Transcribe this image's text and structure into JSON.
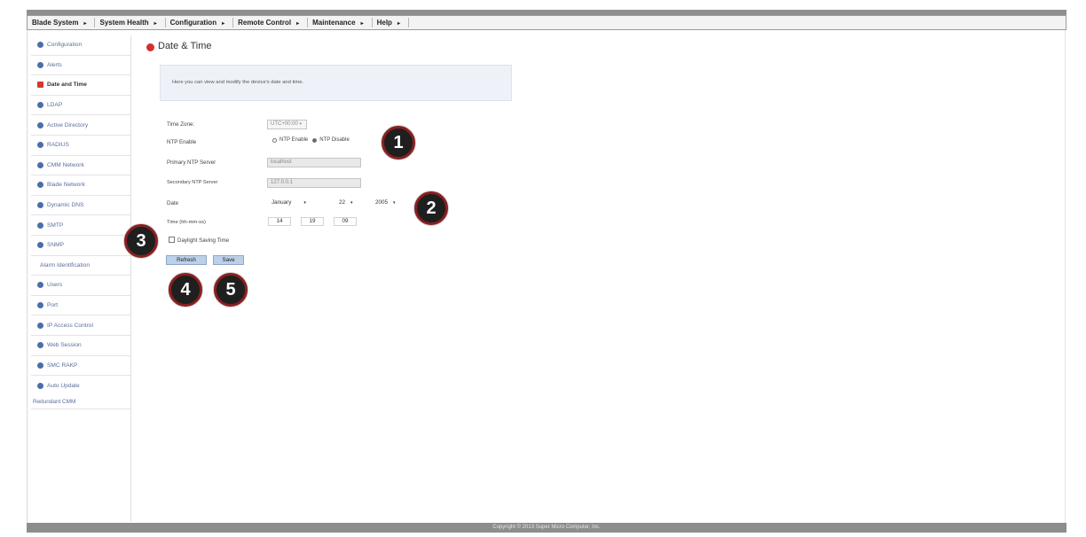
{
  "menu": [
    {
      "label": "Blade System",
      "arrow": "▸"
    },
    {
      "label": "System Health",
      "arrow": "▸"
    },
    {
      "label": "Configuration",
      "arrow": "▸"
    },
    {
      "label": "Remote Control",
      "arrow": "▸"
    },
    {
      "label": "Maintenance",
      "arrow": "▸"
    },
    {
      "label": "Help",
      "arrow": "▸"
    }
  ],
  "sidebar": {
    "items": [
      {
        "label": "Configuration",
        "icon": "config-icon"
      },
      {
        "label": "Alerts",
        "icon": "config-icon"
      },
      {
        "label": "Date and Time",
        "icon": "config-icon",
        "active": true
      },
      {
        "label": "LDAP",
        "icon": "config-icon"
      },
      {
        "label": "Active Directory",
        "icon": "config-icon"
      },
      {
        "label": "RADIUS",
        "icon": "config-icon"
      },
      {
        "label": "CMM Network",
        "icon": "config-icon"
      },
      {
        "label": "Blade Network",
        "icon": "config-icon"
      },
      {
        "label": "Dynamic DNS",
        "icon": "config-icon"
      },
      {
        "label": "SMTP",
        "icon": "config-icon"
      },
      {
        "label": "SNMP",
        "icon": "config-icon"
      },
      {
        "label": "Alarm Identification",
        "icon": ""
      },
      {
        "label": "Users",
        "icon": "config-icon"
      },
      {
        "label": "Port",
        "icon": "config-icon"
      },
      {
        "label": "IP Access Control",
        "icon": "config-icon"
      },
      {
        "label": "Web Session",
        "icon": "config-icon"
      },
      {
        "label": "SMC RAKP",
        "icon": "config-icon"
      },
      {
        "label": "Auto Update",
        "icon": "config-icon"
      }
    ],
    "tail": "Redundant CMM"
  },
  "page": {
    "title": "Date & Time",
    "info": "Here you can view and modify the device's date and time."
  },
  "form": {
    "time_zone_label": "Time Zone:",
    "time_zone_value": "UTC+00:00",
    "ntp_label": "NTP Enable",
    "ntp_enable_label": "NTP Enable",
    "ntp_disable_label": "NTP Disable",
    "ntp_selected": "disable",
    "primary_label": "Primary NTP Server",
    "primary_value": "localhost",
    "secondary_label": "Secondary NTP Server",
    "secondary_value": "127.0.0.1",
    "date_label": "Date",
    "month": "January",
    "day": "22",
    "year": "2005",
    "time_label": "Time (hh-mm-ss)",
    "hour": "14",
    "minute": "19",
    "second": "09",
    "dst_label": "Daylight Saving Time",
    "dst_checked": false
  },
  "buttons": {
    "refresh": "Refresh",
    "save": "Save"
  },
  "callouts": [
    "1",
    "2",
    "3",
    "4",
    "5"
  ],
  "footer": "Copyright © 2013 Super Micro Computer, Inc."
}
